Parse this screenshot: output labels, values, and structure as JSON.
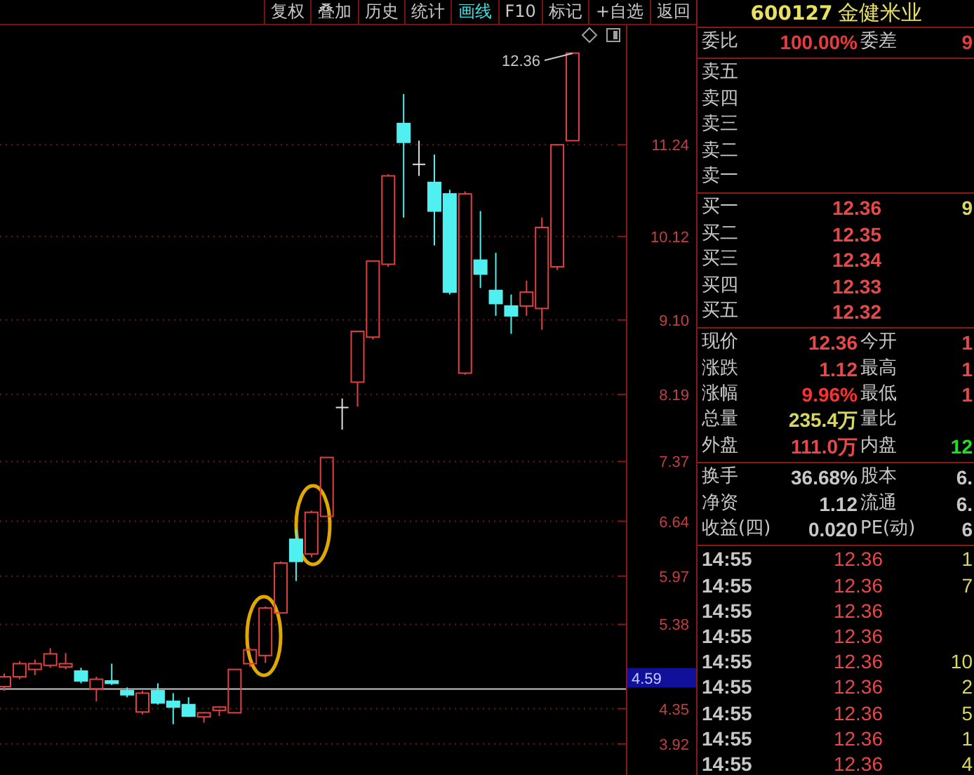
{
  "toolbar": {
    "buttons": [
      {
        "label": "复权",
        "selected": false
      },
      {
        "label": "叠加",
        "selected": false
      },
      {
        "label": "历史",
        "selected": false
      },
      {
        "label": "统计",
        "selected": false
      },
      {
        "label": "画线",
        "selected": true
      },
      {
        "label": "F10",
        "selected": false
      },
      {
        "label": "标记",
        "selected": false
      },
      {
        "label": "+自选",
        "selected": false
      },
      {
        "label": "返回",
        "selected": false
      }
    ]
  },
  "chart": {
    "last_price_label": "12.36",
    "chart_data": {
      "type": "candlestick",
      "grid": true,
      "ylim": [
        3.54,
        12.7
      ],
      "ohlc": [
        [
          4.62,
          4.78,
          4.57,
          4.74
        ],
        [
          4.74,
          4.93,
          4.71,
          4.9
        ],
        [
          4.83,
          4.95,
          4.76,
          4.9
        ],
        [
          4.88,
          5.09,
          4.85,
          5.02
        ],
        [
          4.86,
          5.03,
          4.83,
          4.9
        ],
        [
          4.81,
          4.85,
          4.66,
          4.69
        ],
        [
          4.59,
          4.74,
          4.44,
          4.71
        ],
        [
          4.69,
          4.9,
          4.64,
          4.66
        ],
        [
          4.57,
          4.61,
          4.49,
          4.52
        ],
        [
          4.31,
          4.57,
          4.28,
          4.54
        ],
        [
          4.57,
          4.66,
          4.4,
          4.42
        ],
        [
          4.44,
          4.54,
          4.16,
          4.37
        ],
        [
          4.4,
          4.49,
          4.25,
          4.26
        ],
        [
          4.25,
          4.31,
          4.18,
          4.3
        ],
        [
          4.33,
          4.38,
          4.26,
          4.37
        ],
        [
          4.3,
          4.83,
          4.3,
          4.83
        ],
        [
          4.9,
          5.09,
          4.86,
          5.07
        ],
        [
          5.0,
          5.6,
          4.91,
          5.58
        ],
        [
          5.52,
          6.15,
          5.52,
          6.13
        ],
        [
          6.42,
          6.54,
          5.91,
          6.15
        ],
        [
          6.24,
          6.77,
          6.2,
          6.75
        ],
        [
          6.7,
          7.42,
          6.7,
          7.42
        ],
        [
          8.03,
          8.14,
          7.76,
          8.03
        ],
        [
          8.34,
          8.96,
          8.04,
          8.96
        ],
        [
          8.89,
          9.82,
          8.86,
          9.82
        ],
        [
          9.78,
          10.88,
          9.75,
          10.86
        ],
        [
          11.5,
          11.86,
          10.35,
          11.27
        ],
        [
          11.0,
          11.29,
          10.86,
          11.0
        ],
        [
          10.78,
          11.12,
          10.01,
          10.43
        ],
        [
          10.64,
          10.69,
          9.41,
          9.44
        ],
        [
          8.45,
          10.67,
          8.43,
          10.64
        ],
        [
          9.83,
          10.43,
          9.49,
          9.66
        ],
        [
          9.46,
          9.92,
          9.15,
          9.3
        ],
        [
          9.27,
          9.41,
          8.93,
          9.15
        ],
        [
          9.27,
          9.58,
          9.15,
          9.44
        ],
        [
          9.24,
          10.35,
          8.98,
          10.23
        ],
        [
          9.75,
          11.24,
          9.71,
          11.24
        ],
        [
          11.29,
          12.36,
          11.29,
          12.36
        ]
      ],
      "yticks": [
        {
          "value": 11.24,
          "label": "11.24"
        },
        {
          "value": 10.12,
          "label": "10.12"
        },
        {
          "value": 9.1,
          "label": "9.10"
        },
        {
          "value": 8.19,
          "label": "8.19"
        },
        {
          "value": 7.37,
          "label": "7.37"
        },
        {
          "value": 6.64,
          "label": "6.64"
        },
        {
          "value": 5.97,
          "label": "5.97"
        },
        {
          "value": 5.38,
          "label": "5.38"
        },
        {
          "value": 4.35,
          "label": "4.35"
        },
        {
          "value": 3.92,
          "label": "3.92"
        }
      ],
      "ref_lines": [
        {
          "axis": "y",
          "value": 4.59,
          "label": "4.59",
          "color": "#c8c8c8"
        }
      ]
    }
  },
  "quote_panel": {
    "code": "600127",
    "name": "金健米业",
    "commission": [
      {
        "label": "委比",
        "value": "100.00%",
        "color": "#e83c3c"
      },
      {
        "label": "委差",
        "value": "9",
        "color": "#e83c3c"
      }
    ],
    "asks": [
      {
        "label": "卖五"
      },
      {
        "label": "卖四"
      },
      {
        "label": "卖三"
      },
      {
        "label": "卖二"
      },
      {
        "label": "卖一"
      }
    ],
    "bids": [
      {
        "label": "买一",
        "price": "12.36",
        "volume": "9"
      },
      {
        "label": "买二",
        "price": "12.35"
      },
      {
        "label": "买三",
        "price": "12.34"
      },
      {
        "label": "买四",
        "price": "12.33"
      },
      {
        "label": "买五",
        "price": "12.32"
      }
    ],
    "stats": [
      {
        "label": "现价",
        "value": "12.36",
        "color": "#e84848"
      },
      {
        "label": "今开",
        "value": "1",
        "color": "#e84848"
      },
      {
        "label": "涨跌",
        "value": "1.12",
        "color": "#e84848"
      },
      {
        "label": "最高",
        "value": "1",
        "color": "#e84848"
      },
      {
        "label": "涨幅",
        "value": "9.96%",
        "color": "#ff3030"
      },
      {
        "label": "最低",
        "value": "1",
        "color": "#e84848"
      },
      {
        "label": "总量",
        "value": "235.4万",
        "color": "#d8d860"
      },
      {
        "label": "量比"
      },
      {
        "label": "外盘",
        "value": "111.0万",
        "color": "#e84848"
      },
      {
        "label": "内盘",
        "value": "12",
        "color": "#20e020"
      }
    ],
    "fundamentals": [
      {
        "label": "换手",
        "value": "36.68%"
      },
      {
        "label": "股本",
        "value": "6."
      },
      {
        "label": "净资",
        "value": "1.12"
      },
      {
        "label": "流通",
        "value": "6."
      },
      {
        "label": "收益(四)",
        "value": "0.020"
      },
      {
        "label": "PE(动)",
        "value": "6"
      }
    ],
    "ticks": [
      {
        "time": "14:55",
        "price": "12.36",
        "volume": "1"
      },
      {
        "time": "14:55",
        "price": "12.36",
        "volume": "7"
      },
      {
        "time": "14:55",
        "price": "12.36"
      },
      {
        "time": "14:55",
        "price": "12.36"
      },
      {
        "time": "14:55",
        "price": "12.36",
        "volume": "10"
      },
      {
        "time": "14:55",
        "price": "12.36",
        "volume": "2"
      },
      {
        "time": "14:55",
        "price": "12.36",
        "volume": "5"
      },
      {
        "time": "14:55",
        "price": "12.36",
        "volume": "1"
      },
      {
        "time": "14:55",
        "price": "12.36",
        "volume": "4"
      }
    ]
  }
}
